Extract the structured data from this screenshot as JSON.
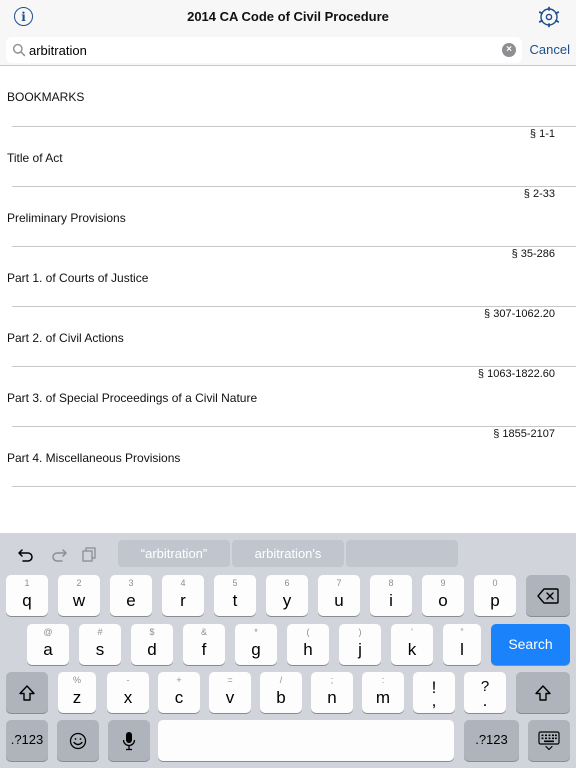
{
  "nav": {
    "title": "2014 CA Code of Civil Procedure",
    "info_icon": "info-icon",
    "settings_icon": "settings-gear-icon"
  },
  "search": {
    "value": "arbitration",
    "placeholder": "",
    "cancel_label": "Cancel"
  },
  "list": {
    "section_header": "BOOKMARKS",
    "rows": [
      {
        "code": "§ 1-1",
        "title": "Title of Act"
      },
      {
        "code": "§ 2-33",
        "title": "Preliminary Provisions"
      },
      {
        "code": "§ 35-286",
        "title": "Part 1.  of Courts of Justice"
      },
      {
        "code": "§ 307-1062.20",
        "title": "Part 2.  of Civil Actions"
      },
      {
        "code": "§ 1063-1822.60",
        "title": "Part 3.  of Special Proceedings of a Civil Nature"
      },
      {
        "code": "§ 1855-2107",
        "title": "Part 4.  Miscellaneous Provisions"
      }
    ]
  },
  "keyboard": {
    "suggestions": [
      "“arbitration”",
      "arbitration's",
      ""
    ],
    "row1": [
      {
        "alt": "1",
        "main": "q"
      },
      {
        "alt": "2",
        "main": "w"
      },
      {
        "alt": "3",
        "main": "e"
      },
      {
        "alt": "4",
        "main": "r"
      },
      {
        "alt": "5",
        "main": "t"
      },
      {
        "alt": "6",
        "main": "y"
      },
      {
        "alt": "7",
        "main": "u"
      },
      {
        "alt": "8",
        "main": "i"
      },
      {
        "alt": "9",
        "main": "o"
      },
      {
        "alt": "0",
        "main": "p"
      }
    ],
    "row2": [
      {
        "alt": "@",
        "main": "a"
      },
      {
        "alt": "#",
        "main": "s"
      },
      {
        "alt": "$",
        "main": "d"
      },
      {
        "alt": "&",
        "main": "f"
      },
      {
        "alt": "*",
        "main": "g"
      },
      {
        "alt": "(",
        "main": "h"
      },
      {
        "alt": ")",
        "main": "j"
      },
      {
        "alt": "’",
        "main": "k"
      },
      {
        "alt": "”",
        "main": "l"
      }
    ],
    "row3": [
      {
        "alt": "%",
        "main": "z"
      },
      {
        "alt": "-",
        "main": "x"
      },
      {
        "alt": "+",
        "main": "c"
      },
      {
        "alt": "=",
        "main": "v"
      },
      {
        "alt": "/",
        "main": "b"
      },
      {
        "alt": ";",
        "main": "n"
      },
      {
        "alt": ":",
        "main": "m"
      },
      {
        "alt": "!",
        "main": ","
      },
      {
        "alt": "?",
        "main": "."
      }
    ],
    "search_label": "Search",
    "numbers_label": ".?123",
    "numbers_label_right": ".?123",
    "emoji_icon": "emoji-icon",
    "mic_icon": "microphone-icon",
    "hide_icon": "hide-keyboard-icon"
  }
}
